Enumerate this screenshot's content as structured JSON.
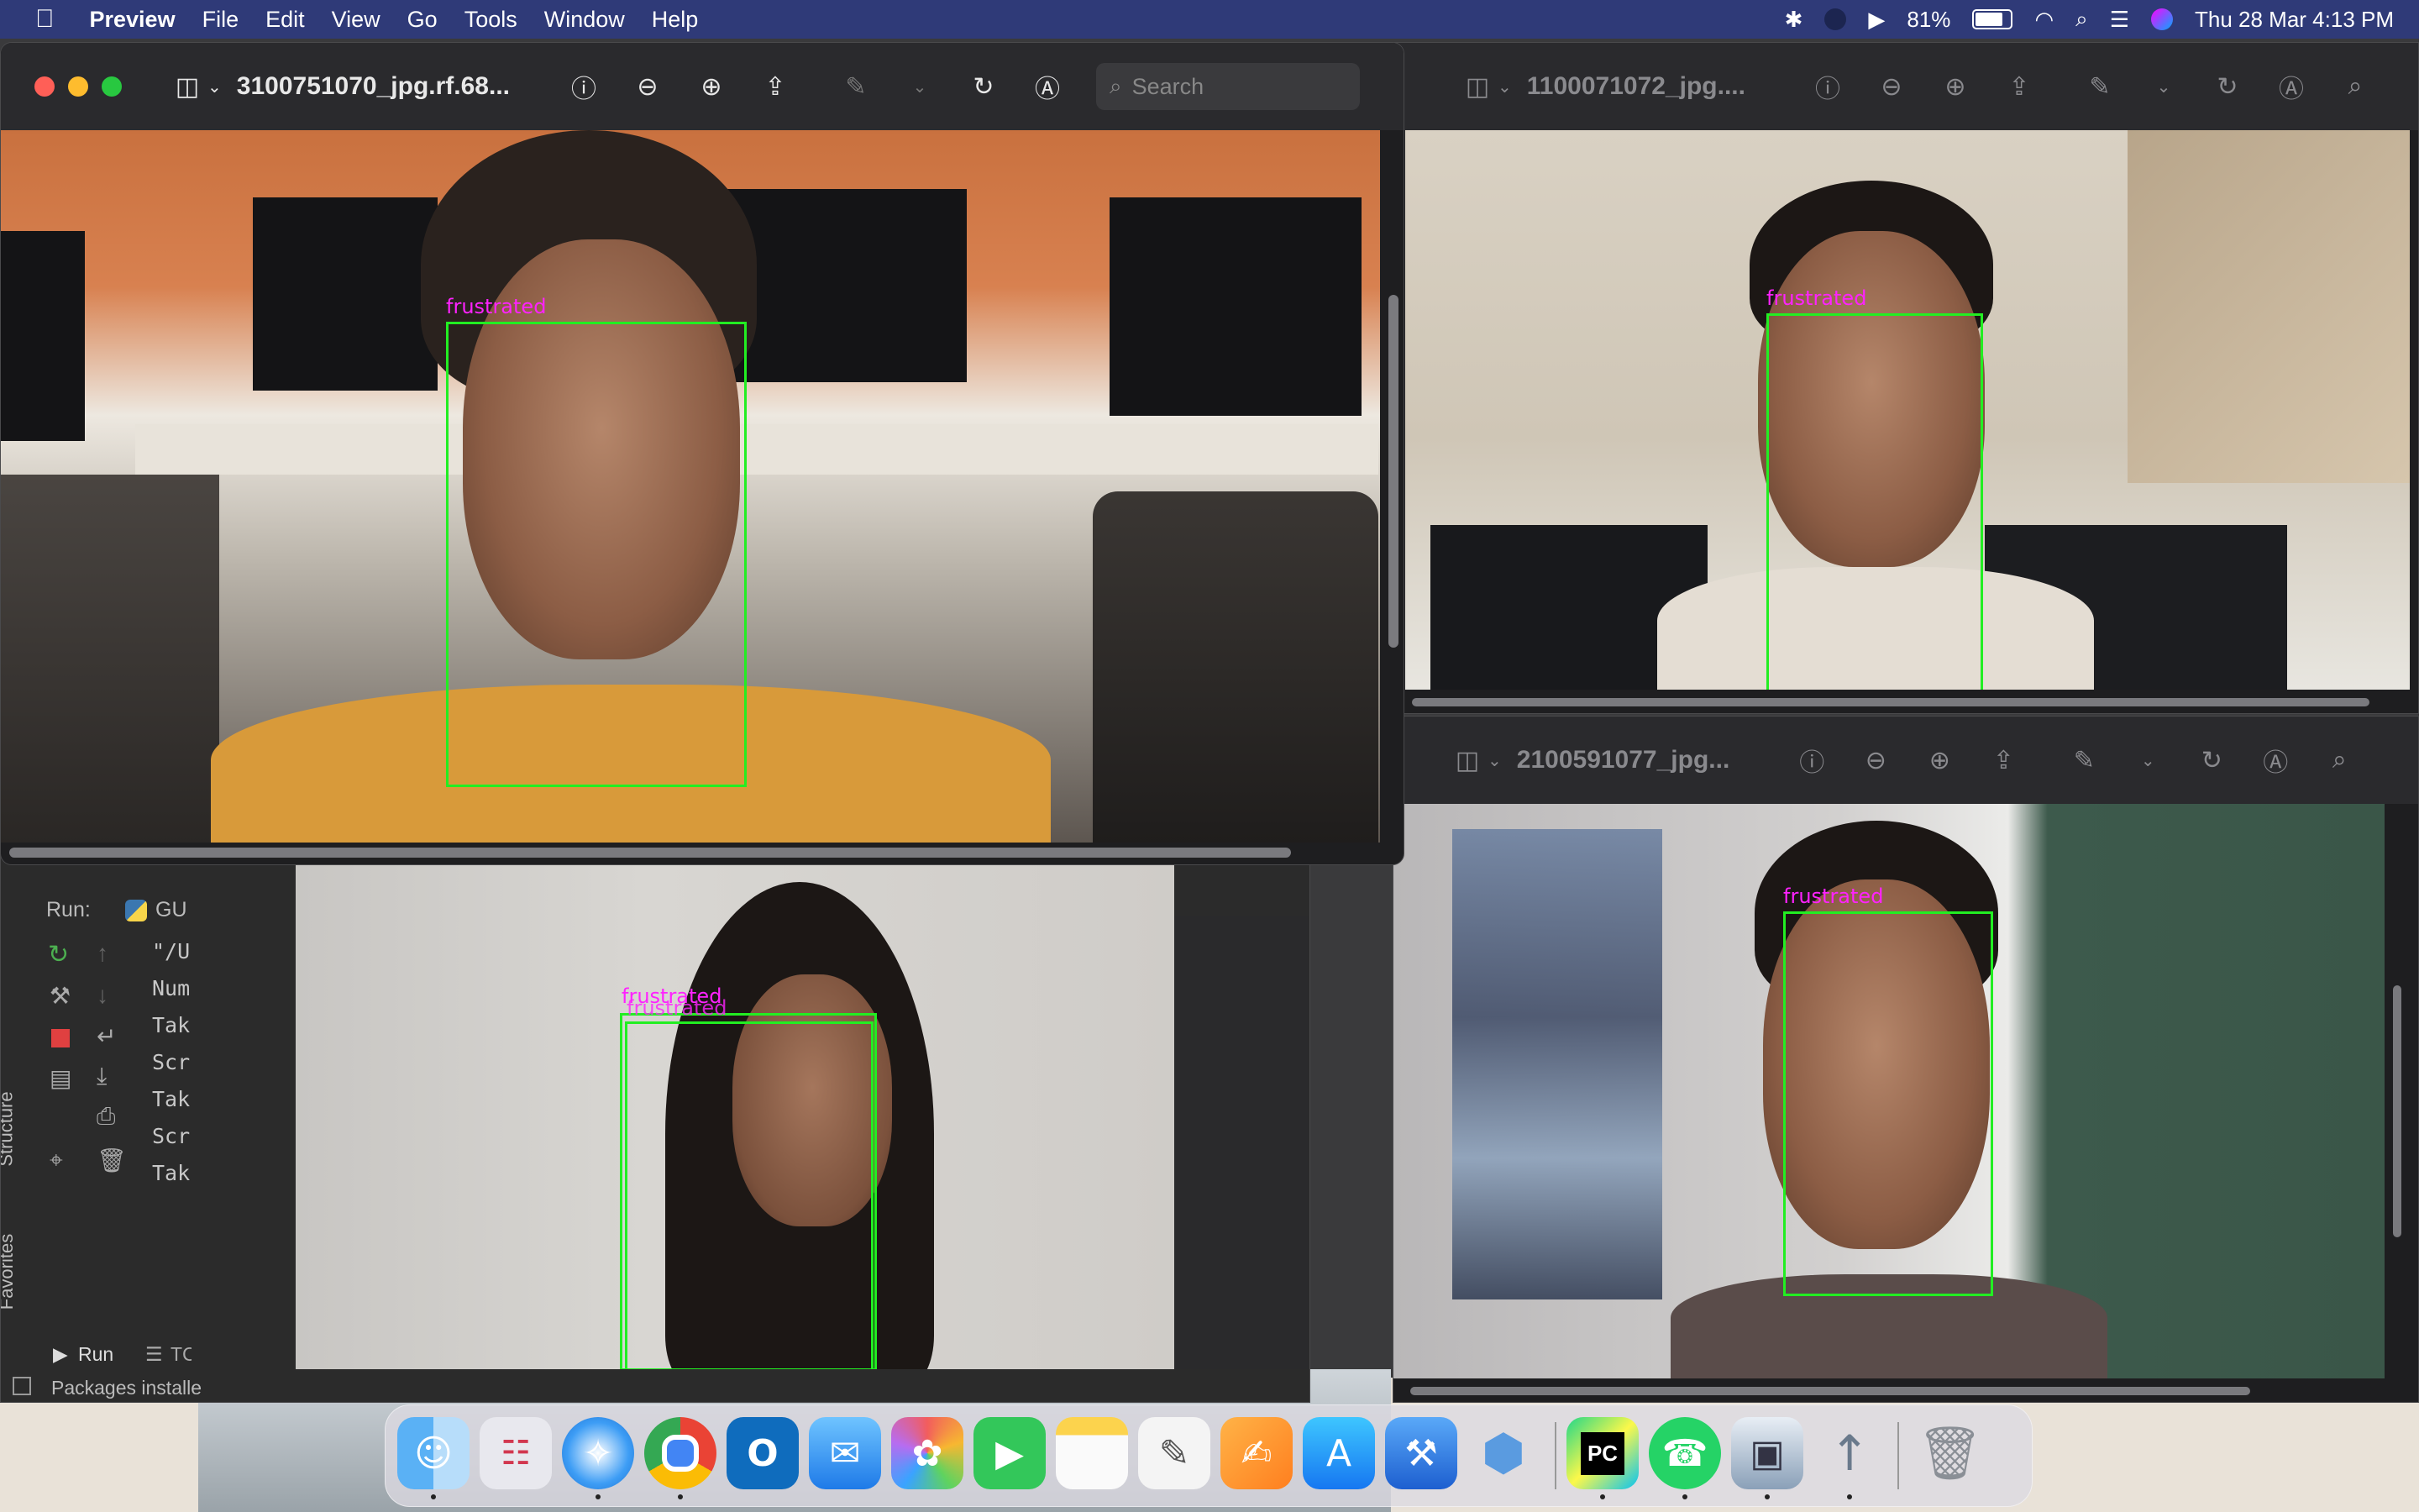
{
  "menubar": {
    "apple": "",
    "app": "Preview",
    "items": [
      "File",
      "Edit",
      "View",
      "Go",
      "Tools",
      "Window",
      "Help"
    ],
    "battery": "81%",
    "datetime": "Thu 28 Mar  4:13 PM"
  },
  "window_main": {
    "title": "3100751070_jpg.rf.68...",
    "search_placeholder": "Search",
    "detection_label": "frustrated"
  },
  "window_top_right": {
    "title": "1100071072_jpg....",
    "detection_label": "frustrated"
  },
  "window_bottom_right": {
    "title": "2100591077_jpg...",
    "detection_label": "frustrated"
  },
  "window_bottom_left": {
    "detection_label_1": "frustrated",
    "detection_label_2": "frustrated"
  },
  "ide": {
    "run_label": "Run:",
    "run_config": "GU",
    "console_lines": [
      "\"/U",
      "Num",
      "Tak",
      "Scr",
      "Tak",
      "Scr",
      "Tak"
    ],
    "side_tabs": [
      "Structure",
      "Favorites"
    ],
    "bottom_tabs": [
      "Run",
      "TC"
    ],
    "status": "Packages installe"
  },
  "dock": {
    "apps": [
      "finder-icon",
      "launchpad-icon",
      "safari-icon",
      "chrome-icon",
      "outlook-icon",
      "mail-icon",
      "photos-icon",
      "facetime-icon",
      "notes-icon",
      "textedit-icon",
      "pages-icon",
      "appstore-icon",
      "xcode-icon",
      "sketchup-icon",
      "pycharm-icon",
      "whatsapp-icon",
      "preview-icon",
      "rocket-icon",
      "trash-icon"
    ],
    "pycharm_text": "PC"
  },
  "colors": {
    "menubar": "#2f3a78",
    "box": "#22ee22",
    "label": "#ff22ff"
  }
}
